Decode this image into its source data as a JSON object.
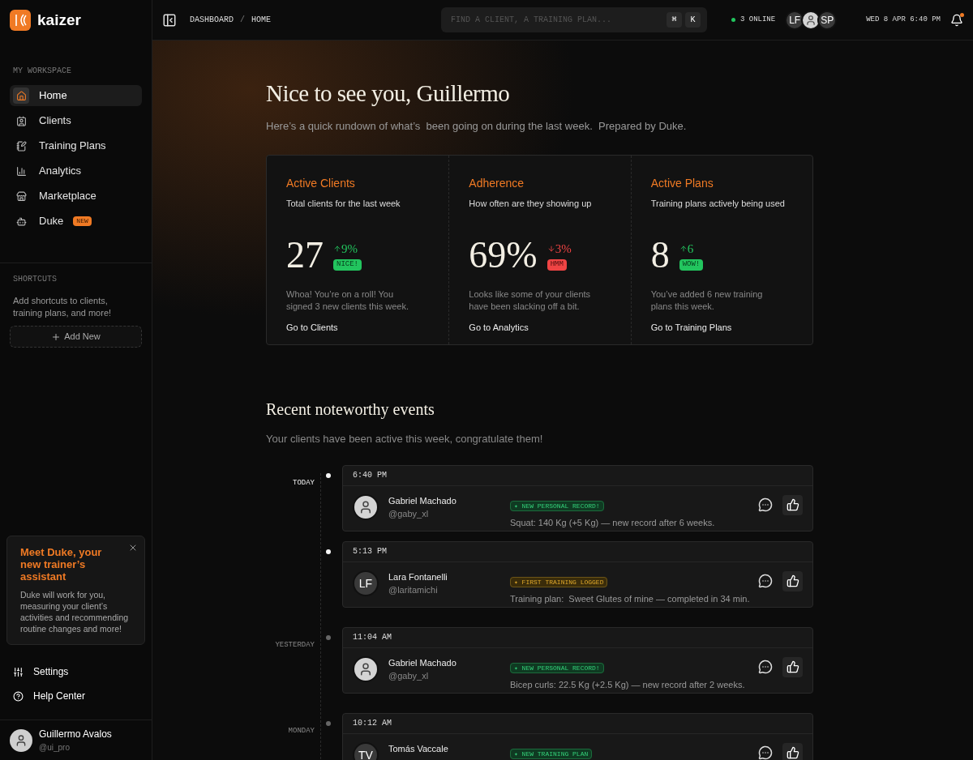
{
  "brand": {
    "name": "kaizer"
  },
  "sidebar": {
    "section_title": "MY WORKSPACE",
    "items": [
      {
        "label": "Home",
        "selected": true
      },
      {
        "label": "Clients",
        "selected": false
      },
      {
        "label": "Training Plans",
        "selected": false
      },
      {
        "label": "Analytics",
        "selected": false
      },
      {
        "label": "Marketplace",
        "selected": false
      },
      {
        "label": "Duke",
        "selected": false,
        "badge": "NEW"
      }
    ],
    "shortcuts": {
      "title": "SHORTCUTS",
      "text": "Add shortcuts to clients, training plans, and more!",
      "button": "Add New"
    },
    "promo": {
      "title": "Meet Duke, your new trainer’s assistant",
      "text": "Duke will work for you, measuring your client’s activities and recommending routine changes and more!"
    },
    "footer_items": [
      {
        "label": "Settings"
      },
      {
        "label": "Help Center"
      }
    ],
    "user": {
      "name": "Guillermo Avalos",
      "handle": "@ui_pro"
    }
  },
  "header": {
    "breadcrumb": [
      "DASHBOARD",
      "HOME"
    ],
    "breadcrumb_separator": "/",
    "search": {
      "placeholder": "FIND A CLIENT, A TRAINING PLAN...",
      "keys": [
        "⌘",
        "K"
      ]
    },
    "online": "3 ONLINE",
    "avatars": [
      {
        "kind": "initials",
        "text": "LF"
      },
      {
        "kind": "photo"
      },
      {
        "kind": "initials",
        "text": "SP"
      }
    ],
    "datetime": "WED 8 APR 6:40 PM",
    "notifications": true
  },
  "greeting": {
    "title": "Nice to see you, Guillermo",
    "subtitle": "Here’s a quick rundown of what’s  been going on during the last week.  Prepared by Duke."
  },
  "stats": [
    {
      "title": "Active Clients",
      "subtitle": "Total clients for the last week",
      "value": "27",
      "delta": {
        "kind": "up",
        "text": "9%"
      },
      "tag": {
        "kind": "good",
        "text": "NICE!"
      },
      "text": "Whoa! You’re on a roll! You signed 3 new clients this week.",
      "link": "Go to Clients"
    },
    {
      "title": "Adherence",
      "subtitle": "How often are they showing up",
      "value": "69%",
      "delta": {
        "kind": "down",
        "text": "3%"
      },
      "tag": {
        "kind": "bad",
        "text": "HMM"
      },
      "text": "Looks like some of your clients have been slacking off a bit.",
      "link": "Go to Analytics"
    },
    {
      "title": "Active Plans",
      "subtitle": "Training plans actively being used",
      "value": "8",
      "delta": {
        "kind": "up",
        "text": "6"
      },
      "tag": {
        "kind": "good",
        "text": "WOW!"
      },
      "text": "You’ve added 6 new training plans this week.",
      "link": "Go to Training Plans"
    }
  ],
  "events": {
    "title": "Recent noteworthy events",
    "subtitle": "Your clients have been active this week, congratulate them!",
    "items": [
      {
        "day": "TODAY",
        "current": true,
        "time": "6:40 PM",
        "avatar": {
          "kind": "photo"
        },
        "name": "Gabriel Machado",
        "handle": "@gaby_xl",
        "badge": {
          "kind": "record",
          "text": "✦ NEW PERSONAL RECORD!"
        },
        "text": "Squat: 140 Kg (+5 Kg) — new record after 6 weeks."
      },
      {
        "current": true,
        "time": "5:13 PM",
        "avatar": {
          "kind": "initials",
          "text": "LF"
        },
        "name": "Lara Fontanelli",
        "handle": "@laritamichi",
        "badge": {
          "kind": "milestone",
          "text": "✦ FIRST TRAINING LOGGED"
        },
        "text": "Training plan:  Sweet Glutes of mine — completed in 34 min."
      },
      {
        "day": "YESTERDAY",
        "current": false,
        "time": "11:04 AM",
        "avatar": {
          "kind": "photo"
        },
        "name": "Gabriel Machado",
        "handle": "@gaby_xl",
        "badge": {
          "kind": "record",
          "text": "✦ NEW PERSONAL RECORD!"
        },
        "text": "Bicep curls: 22.5 Kg (+2.5 Kg) — new record after 2 weeks."
      },
      {
        "day": "MONDAY",
        "current": false,
        "time": "10:12 AM",
        "avatar": {
          "kind": "initials",
          "text": "TV"
        },
        "name": "Tomás Vaccale",
        "badge": {
          "kind": "record",
          "text": "✦ NEW TRAINING PLAN"
        }
      }
    ]
  }
}
